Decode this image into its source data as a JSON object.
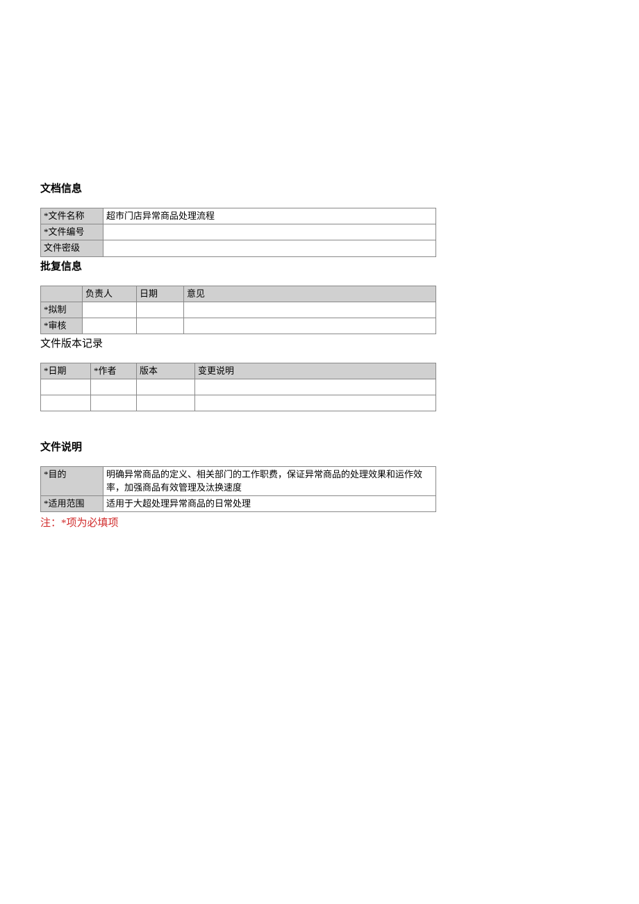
{
  "sections": {
    "docInfo": {
      "title": "文档信息",
      "rows": {
        "fileNameLabel": "*文件名称",
        "fileNameValue": "超市门店异常商品处理流程",
        "fileNumberLabel": "*文件编号",
        "fileNumberValue": "",
        "fileLevelLabel": "文件密级",
        "fileLevelValue": ""
      }
    },
    "approval": {
      "title": "批复信息",
      "headers": {
        "blank": "",
        "person": "负责人",
        "date": "日期",
        "opinion": "意见"
      },
      "rows": {
        "draftLabel": "*拟制",
        "reviewLabel": "*审核"
      }
    },
    "version": {
      "title": "文件版本记录",
      "headers": {
        "date": "*日期",
        "author": "*作者",
        "version": "版本",
        "change": "变更说明"
      }
    },
    "desc": {
      "title": "文件说明",
      "rows": {
        "purposeLabel": "*目的",
        "purposeValue": "明确异常商品的定义、相关部门的工作职费，保证异常商品的处理效果和运作效率，加强商品有效管理及汰换速度",
        "scopeLabel": "*适用范围",
        "scopeValue": "适用于大超处理异常商品的日常处理"
      }
    }
  },
  "note": "注：*项为必填项"
}
